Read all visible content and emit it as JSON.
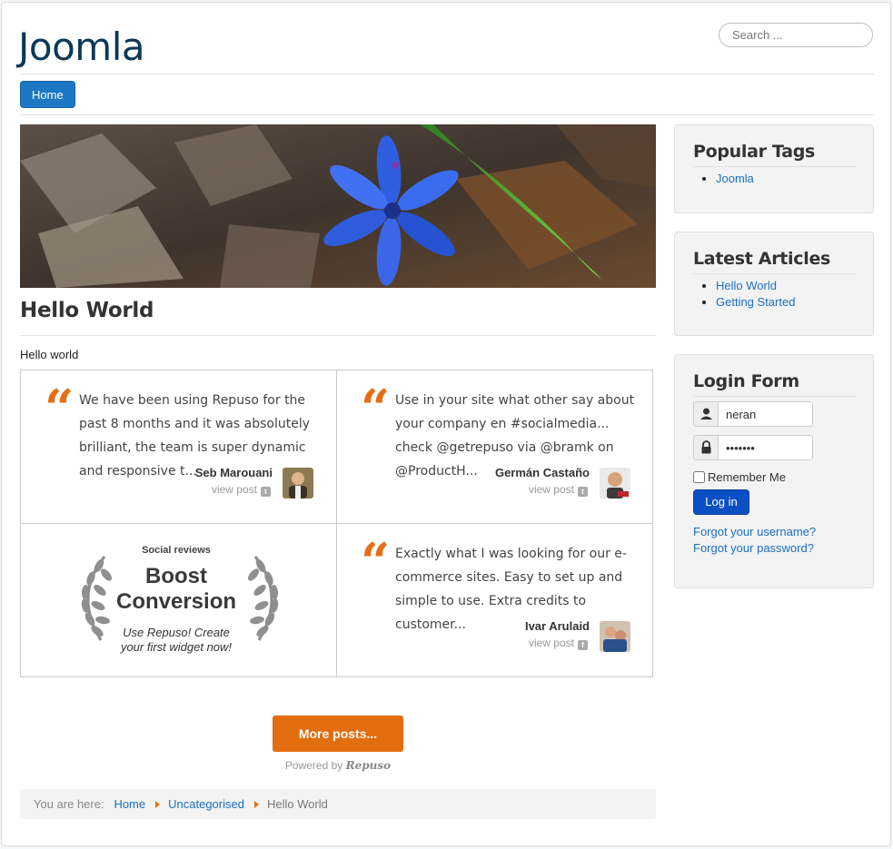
{
  "site": {
    "brand": "Joomla"
  },
  "search": {
    "placeholder": "Search ..."
  },
  "nav": {
    "home": "Home"
  },
  "article": {
    "title": "Hello World",
    "intro": "Hello world"
  },
  "testimonials": [
    {
      "text": "We have been using Repuso for the past 8 months and it was absolutely brilliant, the team is super dynamic and responsive t...",
      "author": "Seb Marouani",
      "link": "view post",
      "source_icon": "twitter-icon"
    },
    {
      "text": "Use in your site what other say about your company en #socialmedia... check @getrepuso via @bramk on @ProductH...",
      "author": "Germán Castaño",
      "link": "view post",
      "source_icon": "twitter-icon"
    },
    {
      "text": "Exactly what I was looking for our e-commerce sites. Easy to set up and simple to use. Extra credits to customer...",
      "author": "Ivar Arulaid",
      "link": "view post",
      "source_icon": "facebook-icon"
    }
  ],
  "promo": {
    "kicker": "Social reviews",
    "headline_1": "Boost",
    "headline_2": "Conversion",
    "sub_1": "Use Repuso! Create",
    "sub_2": "your first widget now!"
  },
  "more_posts": "More posts...",
  "powered": {
    "prefix": "Powered by",
    "brand": "Repuso"
  },
  "breadcrumb": {
    "label": "You are here:",
    "items": [
      "Home",
      "Uncategorised"
    ],
    "current": "Hello World"
  },
  "sidebar": {
    "popular_tags": {
      "title": "Popular Tags",
      "items": [
        "Joomla"
      ]
    },
    "latest_articles": {
      "title": "Latest Articles",
      "items": [
        "Hello World",
        "Getting Started"
      ]
    },
    "login": {
      "title": "Login Form",
      "username": "neran",
      "password": "•••••••",
      "remember": "Remember Me",
      "button": "Log in",
      "forgot_username": "Forgot your username?",
      "forgot_password": "Forgot your password?"
    }
  },
  "colors": {
    "accent": "#e26d0e",
    "link": "#1a6fc1",
    "brand": "#0b3856",
    "nav": "#1c78c5"
  }
}
